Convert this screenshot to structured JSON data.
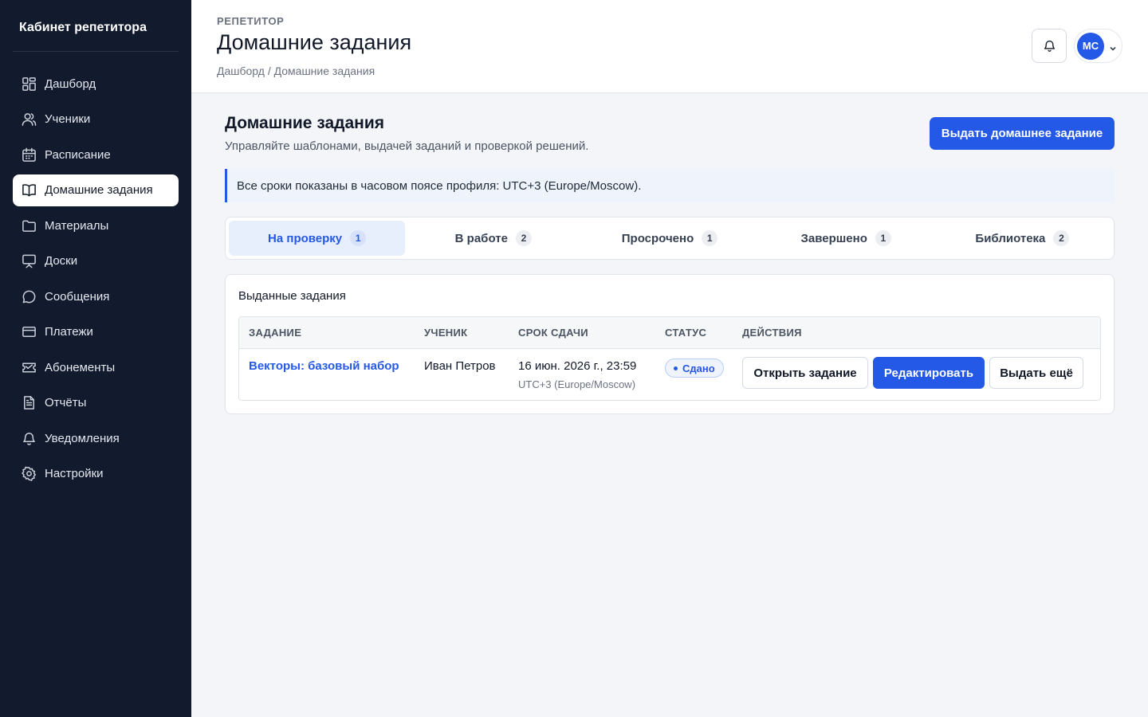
{
  "sidebar": {
    "brand": "Кабинет репетитора",
    "items": [
      {
        "label": "Дашборд",
        "icon": "grid-icon"
      },
      {
        "label": "Ученики",
        "icon": "users-icon"
      },
      {
        "label": "Расписание",
        "icon": "calendar-icon"
      },
      {
        "label": "Домашние задания",
        "icon": "book-icon",
        "active": true
      },
      {
        "label": "Материалы",
        "icon": "folder-icon"
      },
      {
        "label": "Доски",
        "icon": "whiteboard-icon"
      },
      {
        "label": "Сообщения",
        "icon": "chat-icon"
      },
      {
        "label": "Платежи",
        "icon": "card-icon"
      },
      {
        "label": "Абонементы",
        "icon": "ticket-icon"
      },
      {
        "label": "Отчёты",
        "icon": "report-icon"
      },
      {
        "label": "Уведомления",
        "icon": "bell-icon"
      },
      {
        "label": "Настройки",
        "icon": "gear-icon"
      }
    ]
  },
  "header": {
    "eyebrow": "РЕПЕТИТОР",
    "title": "Домашние задания",
    "breadcrumb": "Дашборд / Домашние задания",
    "avatar_initials": "МС"
  },
  "main": {
    "title": "Домашние задания",
    "subtitle": "Управляйте шаблонами, выдачей заданий и проверкой решений.",
    "primary_action": "Выдать домашнее задание",
    "notice": "Все сроки показаны в часовом поясе профиля: UTC+3 (Europe/Moscow).",
    "tabs": [
      {
        "label": "На проверку",
        "count": "1",
        "active": true
      },
      {
        "label": "В работе",
        "count": "2"
      },
      {
        "label": "Просрочено",
        "count": "1"
      },
      {
        "label": "Завершено",
        "count": "1"
      },
      {
        "label": "Библиотека",
        "count": "2"
      }
    ],
    "card_title": "Выданные задания",
    "table": {
      "headers": [
        "ЗАДАНИЕ",
        "УЧЕНИК",
        "СРОК СДАЧИ",
        "СТАТУС",
        "ДЕЙСТВИЯ"
      ],
      "rows": [
        {
          "task": "Векторы: базовый набор",
          "student": "Иван Петров",
          "due": "16 июн. 2026 г., 23:59",
          "tz": "UTC+3 (Europe/Moscow)",
          "status": "Сдано",
          "actions": [
            "Открыть задание",
            "Редактировать",
            "Выдать ещё"
          ]
        }
      ]
    }
  },
  "colors": {
    "sidebar_bg": "#121a2d",
    "accent": "#2458e6",
    "page_bg": "#f3f5f9"
  }
}
